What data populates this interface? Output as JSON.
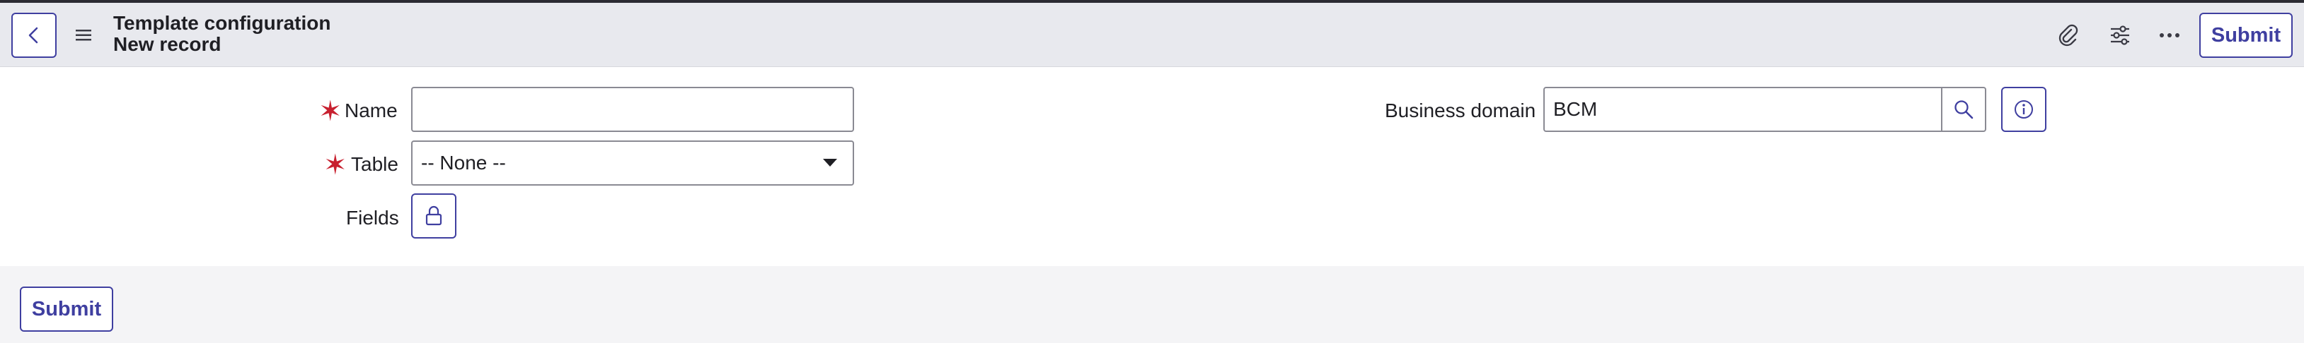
{
  "header": {
    "title": "Template configuration",
    "subtitle": "New record",
    "submit_label": "Submit"
  },
  "form": {
    "name_label": "Name",
    "name_value": "",
    "table_label": "Table",
    "table_selected": "-- None --",
    "fields_label": "Fields",
    "business_domain_label": "Business domain",
    "business_domain_value": "BCM"
  },
  "footer": {
    "submit_label": "Submit"
  },
  "colors": {
    "accent": "#3f3fa0",
    "required": "#c8202f",
    "header_bg": "#e8e9ee"
  },
  "icons": [
    "back-icon",
    "menu-icon",
    "attachment-icon",
    "settings-sliders-icon",
    "more-icon",
    "search-icon",
    "info-icon",
    "lock-icon",
    "chevron-down-icon"
  ]
}
